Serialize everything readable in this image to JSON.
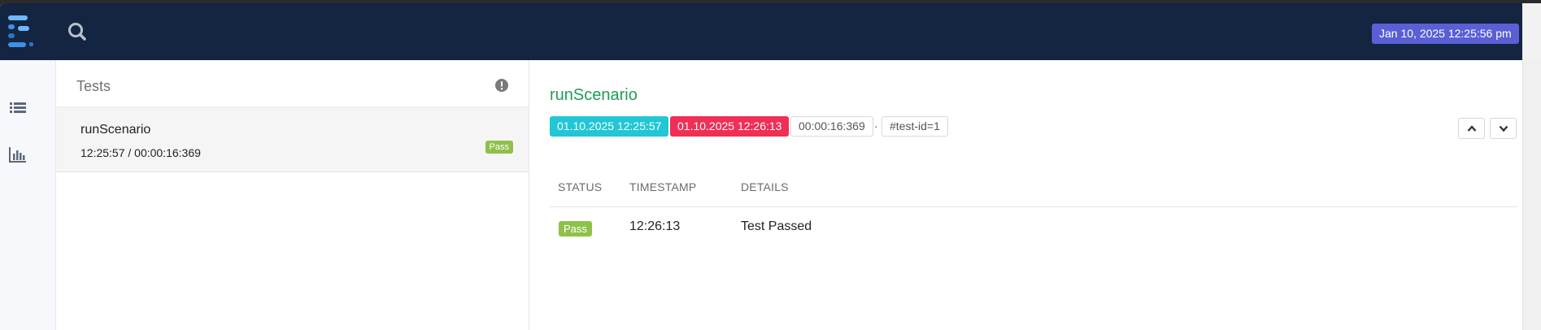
{
  "header": {
    "logo_icon": "extent-logo-icon",
    "search_icon": "search-icon",
    "datetime": "Jan 10, 2025 12:25:56 pm"
  },
  "sidebar": {
    "items": [
      {
        "icon": "list-icon"
      },
      {
        "icon": "bar-chart-icon"
      }
    ]
  },
  "test_list": {
    "title": "Tests",
    "alert_icon": "exclamation-circle-icon",
    "items": [
      {
        "name": "runScenario",
        "meta": "12:25:57 / 00:00:16:369",
        "status": "Pass"
      }
    ]
  },
  "detail": {
    "title": "runScenario",
    "start": "01.10.2025 12:25:57",
    "end": "01.10.2025 12:26:13",
    "duration": "00:00:16:369",
    "separator": "·",
    "test_id": "#test-id=1",
    "columns": [
      "STATUS",
      "TIMESTAMP",
      "DETAILS"
    ],
    "rows": [
      {
        "status": "Pass",
        "timestamp": "12:26:13",
        "details": "Test Passed"
      }
    ]
  },
  "colors": {
    "topbar": "#142542",
    "accent_date": "#5b5fd6",
    "pass": "#8fc14a",
    "start": "#22c6d4",
    "end": "#ef2f55",
    "title_green": "#1f9d55"
  }
}
